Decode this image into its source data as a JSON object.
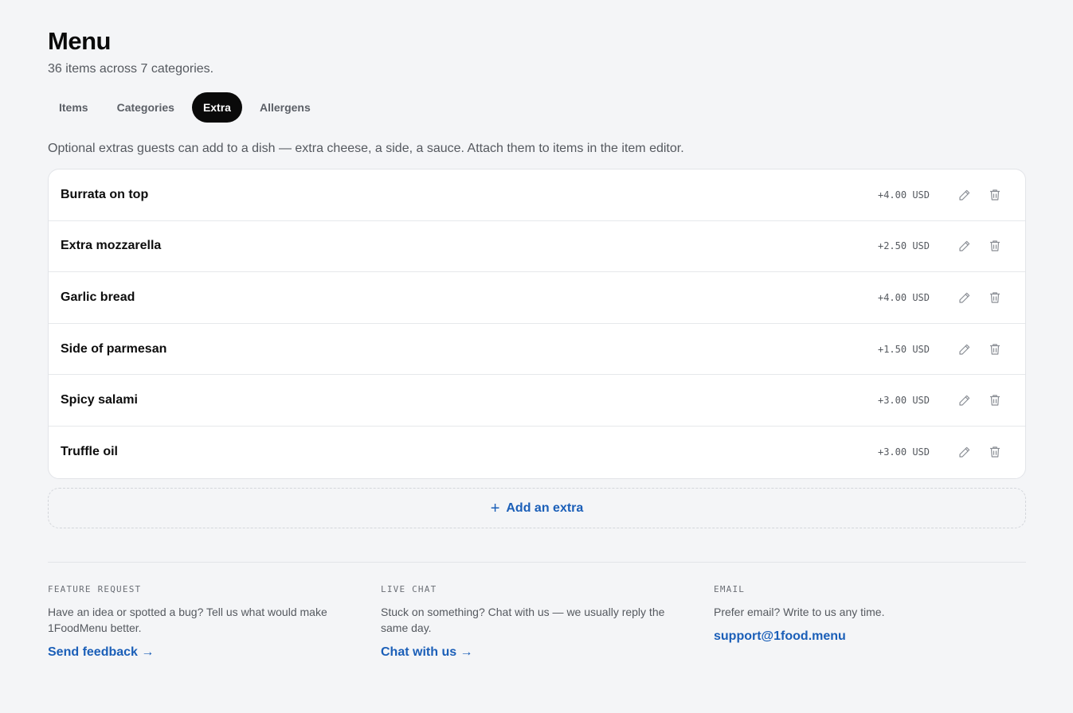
{
  "header": {
    "title": "Menu",
    "subtitle": "36 items across 7 categories."
  },
  "tabs": [
    {
      "label": "Items",
      "active": false
    },
    {
      "label": "Categories",
      "active": false
    },
    {
      "label": "Extra",
      "active": true
    },
    {
      "label": "Allergens",
      "active": false
    }
  ],
  "description": "Optional extras guests can add to a dish — extra cheese, a side, a sauce. Attach them to items in the item editor.",
  "extras": [
    {
      "name": "Burrata on top",
      "price": "+4.00 USD"
    },
    {
      "name": "Extra mozzarella",
      "price": "+2.50 USD"
    },
    {
      "name": "Garlic bread",
      "price": "+4.00 USD"
    },
    {
      "name": "Side of parmesan",
      "price": "+1.50 USD"
    },
    {
      "name": "Spicy salami",
      "price": "+3.00 USD"
    },
    {
      "name": "Truffle oil",
      "price": "+3.00 USD"
    }
  ],
  "icons": {
    "edit": "pencil-icon",
    "delete": "trash-icon",
    "add": "plus-icon"
  },
  "add_extra": {
    "plus": "+",
    "label": "Add an extra"
  },
  "footer": {
    "feature": {
      "label": "FEATURE REQUEST",
      "text": "Have an idea or spotted a bug? Tell us what would make 1FoodMenu better.",
      "link": "Send feedback →"
    },
    "chat": {
      "label": "LIVE CHAT",
      "text": "Stuck on something? Chat with us — we usually reply the same day.",
      "link": "Chat with us →"
    },
    "email": {
      "label": "EMAIL",
      "text": "Prefer email? Write to us any time.",
      "link": "support@1food.menu"
    }
  },
  "colors": {
    "accent": "#1b5fb8",
    "active_tab_bg": "#0a0a0a",
    "background": "#f4f5f7"
  }
}
